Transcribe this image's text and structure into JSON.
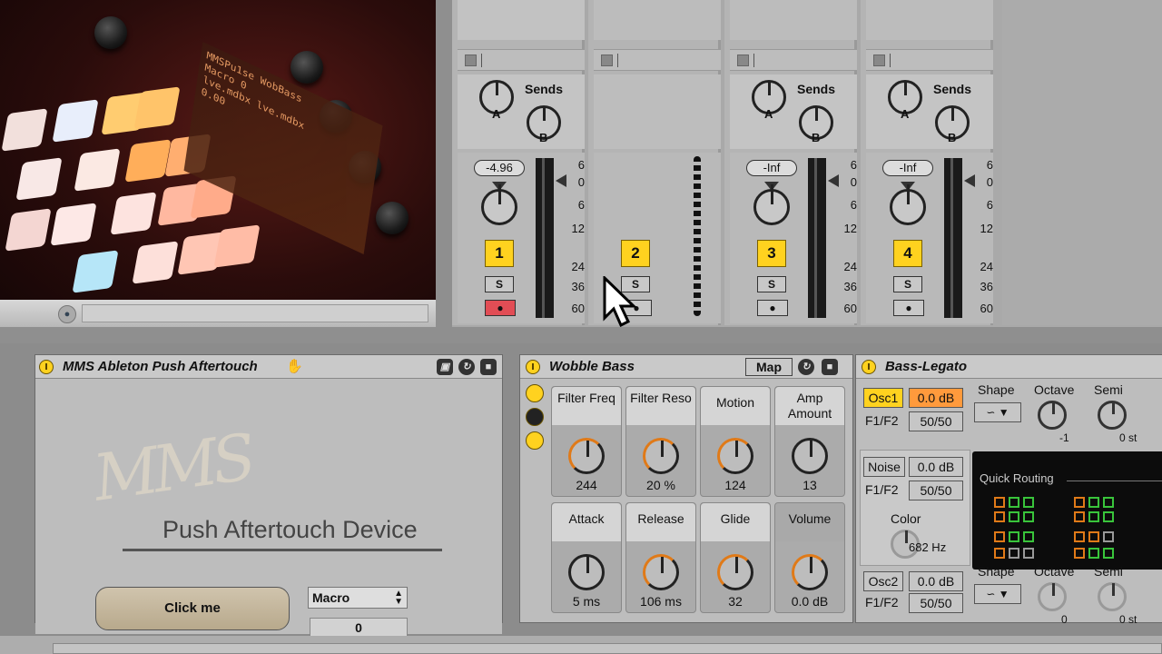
{
  "photo": {
    "lcd_lines": [
      "MMSPu1se  WobBass",
      "Macro        0",
      "lve.mdbx  lve.mdbx",
      "           0.00"
    ]
  },
  "mixer": {
    "sends_label": "Sends",
    "knob_a": "A",
    "knob_b": "B",
    "scale": [
      "6",
      "0",
      "6",
      "12",
      "24",
      "36",
      "60"
    ],
    "tracks": [
      {
        "number": "1",
        "volume": "-4.96",
        "solo": "S",
        "has_sends": true
      },
      {
        "number": "2",
        "volume": "",
        "solo": "S",
        "has_sends": false
      },
      {
        "number": "3",
        "volume": "-Inf",
        "solo": "S",
        "has_sends": true
      },
      {
        "number": "4",
        "volume": "-Inf",
        "solo": "S",
        "has_sends": true
      }
    ]
  },
  "mms_device": {
    "title": "MMS Ableton Push Aftertouch",
    "logo": "MMS",
    "subtitle": "Push Aftertouch Device",
    "button": "Click me",
    "select_value": "Macro",
    "number_value": "0"
  },
  "wobble": {
    "title": "Wobble Bass",
    "map_label": "Map",
    "macros": [
      {
        "label": "Filter Freq",
        "value": "244"
      },
      {
        "label": "Filter Reso",
        "value": "20 %"
      },
      {
        "label": "Motion",
        "value": "124"
      },
      {
        "label": "Amp Amount",
        "value": "13"
      },
      {
        "label": "Attack",
        "value": "5 ms"
      },
      {
        "label": "Release",
        "value": "106 ms"
      },
      {
        "label": "Glide",
        "value": "32"
      },
      {
        "label": "Volume",
        "value": "0.0 dB"
      }
    ]
  },
  "bass_legato": {
    "title": "Bass-Legato",
    "osc1": "Osc1",
    "osc1_db": "0.0 dB",
    "f1f2": "F1/F2",
    "osc1_mix": "50/50",
    "shape": "Shape",
    "octave": "Octave",
    "semi": "Semi",
    "osc1_octave": "-1",
    "osc1_semi": "0 st",
    "noise": "Noise",
    "noise_db": "0.0 dB",
    "noise_mix": "50/50",
    "color": "Color",
    "color_value": "682 Hz",
    "quick_routing": "Quick Routing",
    "osc2": "Osc2",
    "osc2_db": "0.0 dB",
    "osc2_mix": "50/50",
    "osc2_octave": "0",
    "osc2_semi": "0 st"
  },
  "colors": {
    "accent": "#ffd21f",
    "record": "#e24d55",
    "routing_orange": "#e07a18",
    "routing_green": "#39c43b"
  }
}
